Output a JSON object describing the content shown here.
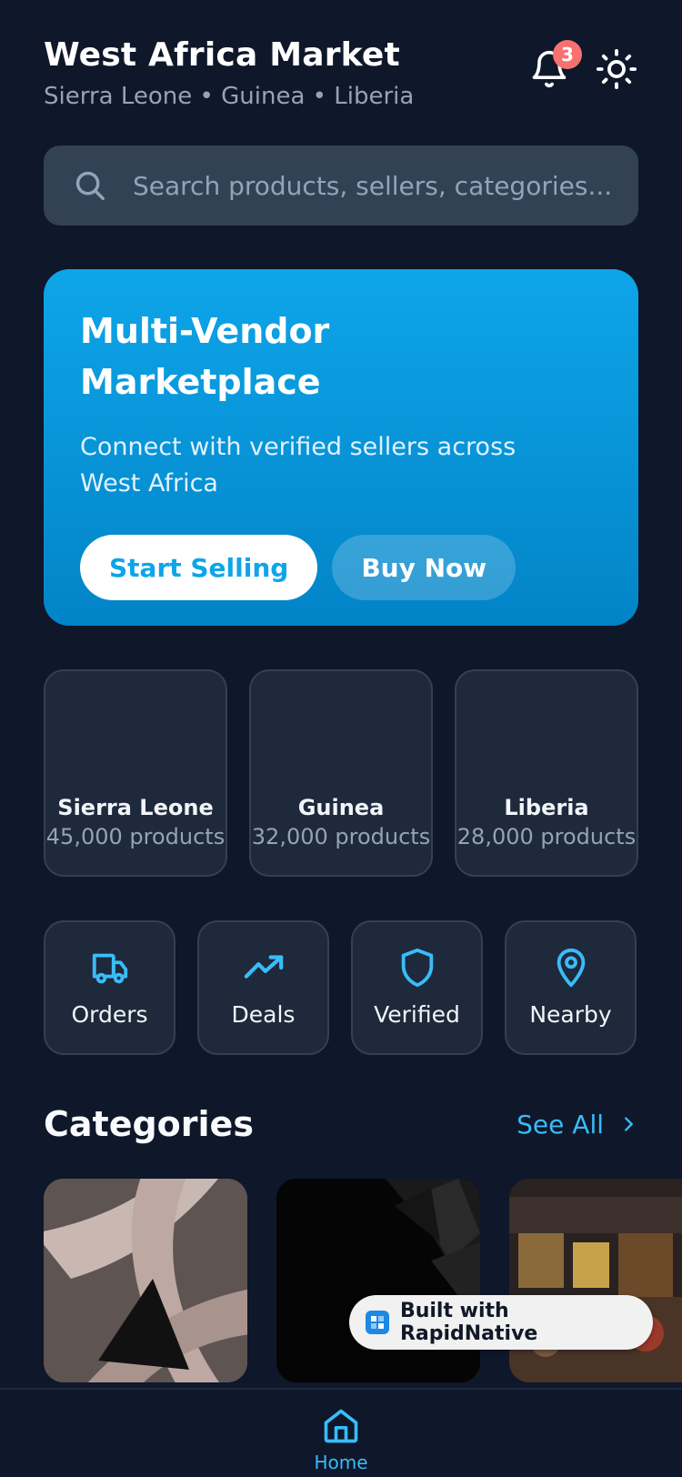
{
  "header": {
    "title": "West Africa Market",
    "subtitle": "Sierra Leone • Guinea • Liberia",
    "notification_count": "3",
    "notification_icon": "bell-icon",
    "theme_icon": "sun-icon"
  },
  "search": {
    "placeholder": "Search products, sellers, categories...",
    "value": ""
  },
  "hero": {
    "title": "Multi-Vendor Marketplace",
    "description": "Connect with verified sellers across West Africa",
    "primary_button": "Start Selling",
    "secondary_button": "Buy Now"
  },
  "countries": [
    {
      "name": "Sierra Leone",
      "count": "45,000 products"
    },
    {
      "name": "Guinea",
      "count": "32,000 products"
    },
    {
      "name": "Liberia",
      "count": "28,000 products"
    }
  ],
  "quick_actions": [
    {
      "label": "Orders",
      "icon": "truck-icon"
    },
    {
      "label": "Deals",
      "icon": "trending-up-icon"
    },
    {
      "label": "Verified",
      "icon": "shield-icon"
    },
    {
      "label": "Nearby",
      "icon": "map-pin-icon"
    }
  ],
  "categories": {
    "title": "Categories",
    "see_all": "See All"
  },
  "built_with": "Built with RapidNative",
  "bottom_nav": {
    "home_label": "Home"
  },
  "colors": {
    "background": "#0f172a",
    "card": "#1e293b",
    "accent": "#38bdf8",
    "hero_start": "#0ea5e9",
    "hero_end": "#0284c7",
    "badge": "#f87171"
  }
}
